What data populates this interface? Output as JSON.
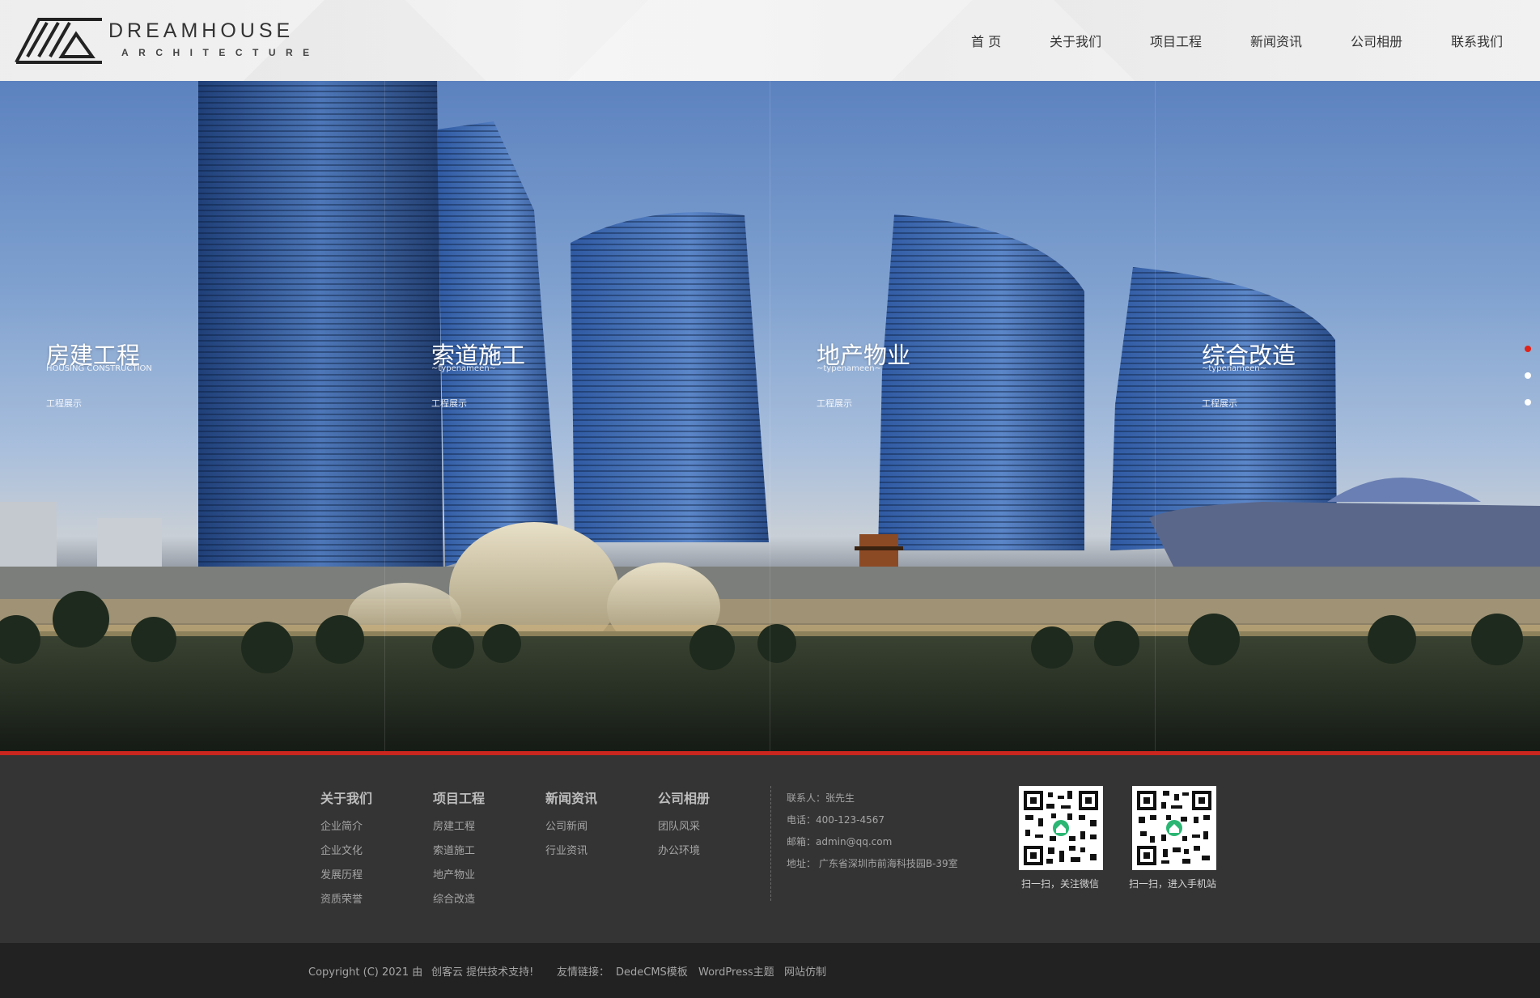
{
  "brand": {
    "logo_icon": "dreamhouse-logo-icon",
    "name": "DREAMHOUSE",
    "tagline": "ARCHITECTURE"
  },
  "nav": {
    "items": [
      {
        "label": "首 页"
      },
      {
        "label": "关于我们"
      },
      {
        "label": "项目工程"
      },
      {
        "label": "新闻资讯"
      },
      {
        "label": "公司相册"
      },
      {
        "label": "联系我们"
      }
    ]
  },
  "hero": {
    "panels": [
      {
        "title": "房建工程",
        "subtitle": "HOUSING CONSTRUCTION",
        "link": "工程展示"
      },
      {
        "title": "索道施工",
        "subtitle": "~typenameen~",
        "link": "工程展示"
      },
      {
        "title": "地产物业",
        "subtitle": "~typenameen~",
        "link": "工程展示"
      },
      {
        "title": "综合改造",
        "subtitle": "~typenameen~",
        "link": "工程展示"
      }
    ],
    "pager": {
      "count": 3,
      "active_index": 0
    },
    "colors": {
      "accent": "#e2231a",
      "divider": "#c8261e"
    }
  },
  "footer": {
    "columns": [
      {
        "title": "关于我们",
        "items": [
          "企业简介",
          "企业文化",
          "发展历程",
          "资质荣誉"
        ]
      },
      {
        "title": "项目工程",
        "items": [
          "房建工程",
          "索道施工",
          "地产物业",
          "综合改造"
        ]
      },
      {
        "title": "新闻资讯",
        "items": [
          "公司新闻",
          "行业资讯"
        ]
      },
      {
        "title": "公司相册",
        "items": [
          "团队风采",
          "办公环境"
        ]
      }
    ],
    "contact": {
      "person": "联系人：张先生",
      "phone": "电话：400-123-4567",
      "email": "邮箱：admin@qq.com",
      "address": "地址：  广东省深圳市前海科技园B-39室"
    },
    "qrcodes": [
      {
        "caption": "扫一扫，关注微信"
      },
      {
        "caption": "扫一扫，进入手机站"
      }
    ]
  },
  "bottom": {
    "copyright": "Copyright (C) 2021 由",
    "provider": "创客云 提供技术支持!",
    "links_label": "友情链接：",
    "links": [
      "DedeCMS模板",
      "WordPress主题",
      "网站仿制"
    ]
  }
}
